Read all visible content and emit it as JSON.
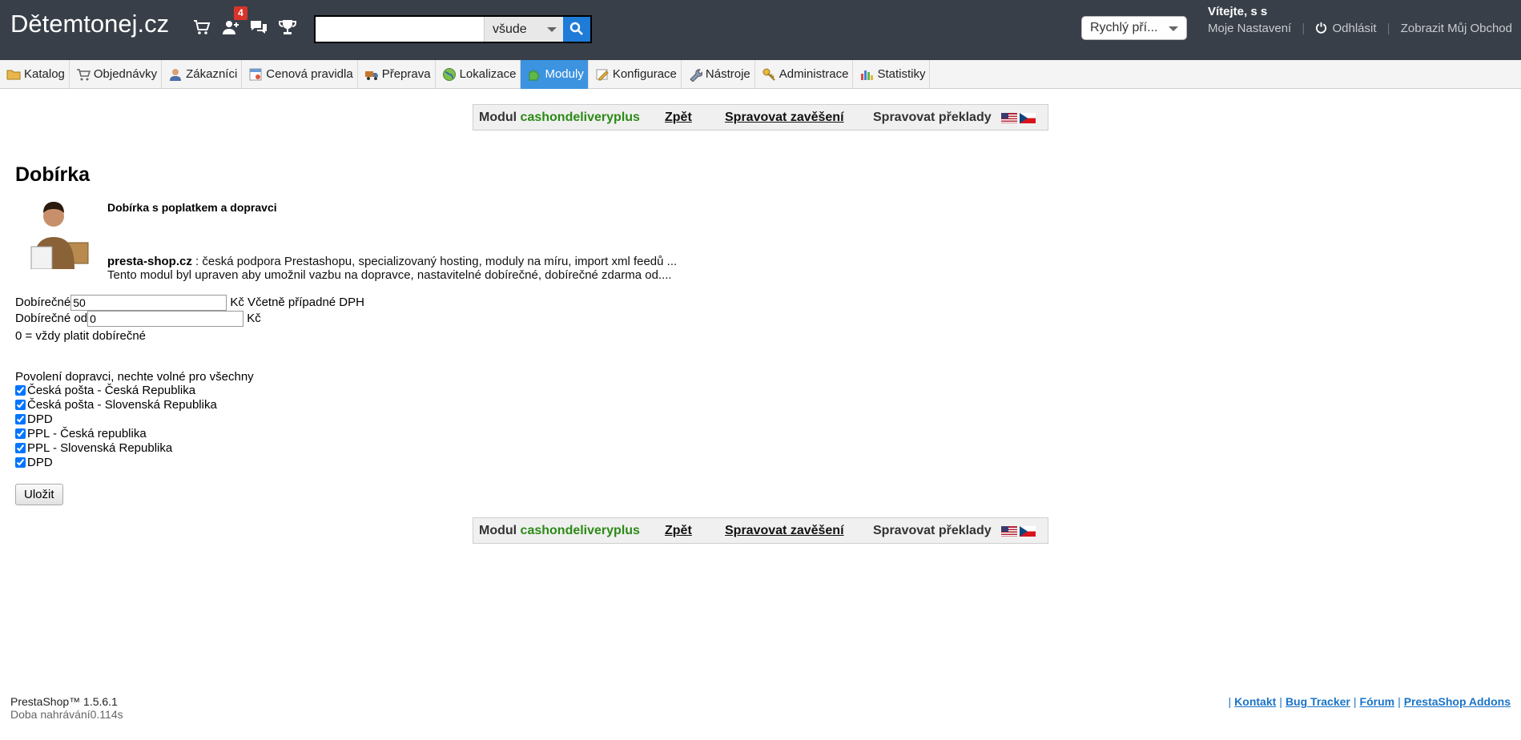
{
  "header": {
    "shop_name": "Dětemtonej.cz",
    "notification_count": "4",
    "search": {
      "value": "",
      "placeholder": "",
      "scope": "všude"
    },
    "quick_access": "Rychlý pří...",
    "welcome": "Vítejte, s s",
    "links": {
      "settings": "Moje Nastavení",
      "logout": "Odhlásit",
      "view_shop": "Zobrazit Můj Obchod"
    }
  },
  "tabs": [
    {
      "label": "Katalog",
      "icon": "folder-icon"
    },
    {
      "label": "Objednávky",
      "icon": "cart-icon"
    },
    {
      "label": "Zákazníci",
      "icon": "user-icon"
    },
    {
      "label": "Cenová pravidla",
      "icon": "price-rules-icon"
    },
    {
      "label": "Přeprava",
      "icon": "truck-icon"
    },
    {
      "label": "Lokalizace",
      "icon": "globe-icon"
    },
    {
      "label": "Moduly",
      "icon": "puzzle-icon",
      "active": true
    },
    {
      "label": "Konfigurace",
      "icon": "config-icon"
    },
    {
      "label": "Nástroje",
      "icon": "wrench-icon"
    },
    {
      "label": "Administrace",
      "icon": "key-icon"
    },
    {
      "label": "Statistiky",
      "icon": "stats-icon"
    }
  ],
  "module_bar": {
    "prefix": "Modul",
    "module_name": "cashondeliveryplus",
    "back": "Zpět",
    "manage_hooks": "Spravovat zavěšení",
    "manage_translations": "Spravovat překlady"
  },
  "content": {
    "title": "Dobírka",
    "subtitle": "Dobírka s poplatkem a dopravci",
    "desc_link": "presta-shop.cz",
    "desc_line1": " : česká podpora Prestashopu, specializovaný hosting, moduly na míru, import xml feedů ...",
    "desc_line2": "Tento modul byl upraven aby umožnil vazbu na dopravce, nastavitelné dobírečné, dobírečné zdarma od....",
    "fee_label": "Dobírečné",
    "fee_value": "50",
    "fee_suffix": " Kč Včetně případné DPH",
    "free_from_label": "Dobírečné od",
    "free_from_value": "0",
    "free_from_suffix": " Kč",
    "zero_note": "0 = vždy platit dobírečné",
    "carriers_label": "Povolení dopravci, nechte volné pro všechny",
    "carriers": [
      {
        "label": "Česká pošta - Česká Republika",
        "checked": true
      },
      {
        "label": "Česká pošta - Slovenská Republika",
        "checked": true
      },
      {
        "label": "DPD",
        "checked": true
      },
      {
        "label": "PPL - Česká republika",
        "checked": true
      },
      {
        "label": "PPL - Slovenská Republika",
        "checked": true
      },
      {
        "label": "DPD",
        "checked": true
      }
    ],
    "save": "Uložit"
  },
  "footer": {
    "version": "PrestaShop™ 1.5.6.1",
    "load_time": "Doba nahrávání0.114s",
    "links": [
      "Kontakt",
      "Bug Tracker",
      "Fórum",
      "PrestaShop Addons"
    ]
  },
  "colors": {
    "header_bg": "#383f48",
    "active_tab": "#3c93e0",
    "module_name": "#2c8a16",
    "link": "#1b74c8",
    "badge": "#d9342b"
  }
}
